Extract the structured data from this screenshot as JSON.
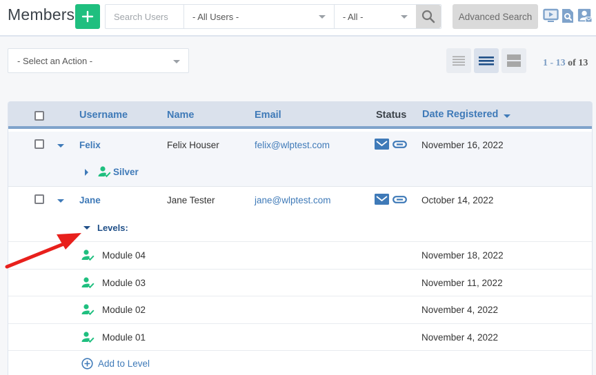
{
  "header": {
    "title": "Members",
    "add_icon": "plus-icon",
    "search": {
      "placeholder": "Search Users",
      "value": ""
    },
    "user_filter": {
      "selected": "- All Users -"
    },
    "status_filter": {
      "selected": "- All -"
    },
    "search_button_icon": "search-icon",
    "advanced_search_label": "Advanced Search",
    "right_icons": [
      "video-tutorial-icon",
      "document-search-icon",
      "user-email-icon"
    ]
  },
  "toolbar": {
    "action_select": {
      "selected": "- Select an Action -"
    },
    "view_modes": [
      {
        "name": "compact",
        "active": false
      },
      {
        "name": "default",
        "active": true
      },
      {
        "name": "expanded",
        "active": false
      }
    ],
    "pager": {
      "range": "1 - 13",
      "of_label": "of",
      "total": "13"
    }
  },
  "table": {
    "columns": {
      "username": "Username",
      "name": "Name",
      "email": "Email",
      "status": "Status",
      "date_registered": "Date Registered"
    },
    "sort": {
      "column": "date_registered",
      "direction": "desc"
    },
    "rows": [
      {
        "username": "Felix",
        "name": "Felix Houser",
        "email": "felix@wlptest.com",
        "status_icons": [
          "envelope-icon",
          "link-icon"
        ],
        "date_registered": "November 16, 2022",
        "levels_collapsed_label": "Silver"
      },
      {
        "username": "Jane",
        "name": "Jane Tester",
        "email": "jane@wlptest.com",
        "status_icons": [
          "envelope-icon",
          "link-icon"
        ],
        "date_registered": "October 14, 2022",
        "levels_label": "Levels:",
        "levels": [
          {
            "name": "Module 04",
            "date": "November 18, 2022"
          },
          {
            "name": "Module 03",
            "date": "November 11, 2022"
          },
          {
            "name": "Module 02",
            "date": "November 4, 2022"
          },
          {
            "name": "Module 01",
            "date": "November 4, 2022"
          }
        ],
        "add_to_level_label": "Add to Level"
      }
    ]
  },
  "colors": {
    "brand_green": "#1fbf7f",
    "link_blue": "#3f7ab8",
    "header_bg": "#dae1ec",
    "annotation_arrow": "#e8201c"
  }
}
